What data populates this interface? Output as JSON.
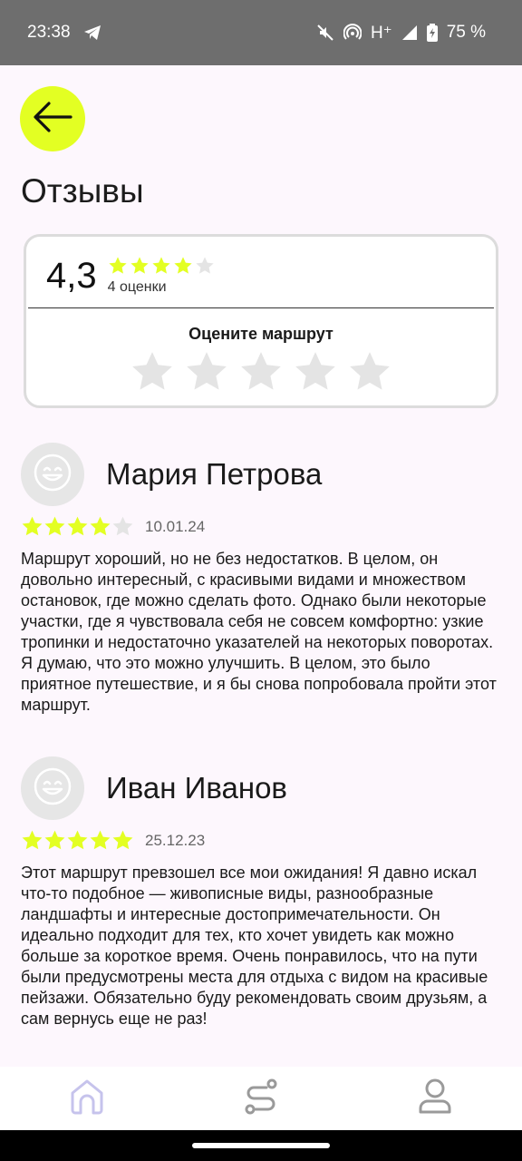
{
  "status_bar": {
    "time": "23:38",
    "network": "H⁺",
    "battery": "75 %",
    "icons": [
      "telegram-icon",
      "mute-icon",
      "hotspot-icon",
      "signal-icon",
      "battery-icon"
    ]
  },
  "header": {
    "back_icon": "arrow-left-icon",
    "title": "Отзывы"
  },
  "rating_summary": {
    "average": "4,3",
    "stars": 4,
    "stars_max": 5,
    "count_label": "4 оценки",
    "rate_prompt": "Оцените маршрут",
    "rate_stars_max": 5
  },
  "reviews": [
    {
      "name": "Мария Петрова",
      "rating": 4,
      "date": "10.01.24",
      "text": "Маршрут хороший, но не без недостатков. В целом, он довольно интересный, с красивыми видами и множеством остановок, где можно сделать фото. Однако были некоторые участки, где я чувствовала себя не совсем комфортно: узкие тропинки и недостаточно указателей на некоторых поворотах. Я думаю, что это можно улучшить. В целом, это было приятное путешествие, и я бы снова попробовала пройти этот маршрут."
    },
    {
      "name": "Иван Иванов",
      "rating": 5,
      "date": "25.12.23",
      "text": "Этот маршрут превзошел все мои ожидания! Я давно искал что-то подобное — живописные виды, разнообразные ландшафты и интересные достопримечательности. Он идеально подходит для тех, кто хочет увидеть как можно больше за короткое время. Очень понравилось, что на пути были предусмотрены места для отдыха с видом на красивые пейзажи. Обязательно буду рекомендовать своим друзьям, а сам вернусь еще не раз!"
    }
  ],
  "bottom_nav": [
    {
      "icon": "home-icon",
      "active": true
    },
    {
      "icon": "route-icon",
      "active": false
    },
    {
      "icon": "profile-icon",
      "active": false
    }
  ],
  "colors": {
    "accent": "#e3ff23",
    "star_filled": "#e3ff23",
    "star_empty": "#e4e4e4",
    "background": "#fdf7fd",
    "status_bar": "#6e6e6e",
    "nav_active": "#c6c3ec",
    "nav_inactive": "#9a9a9a"
  }
}
